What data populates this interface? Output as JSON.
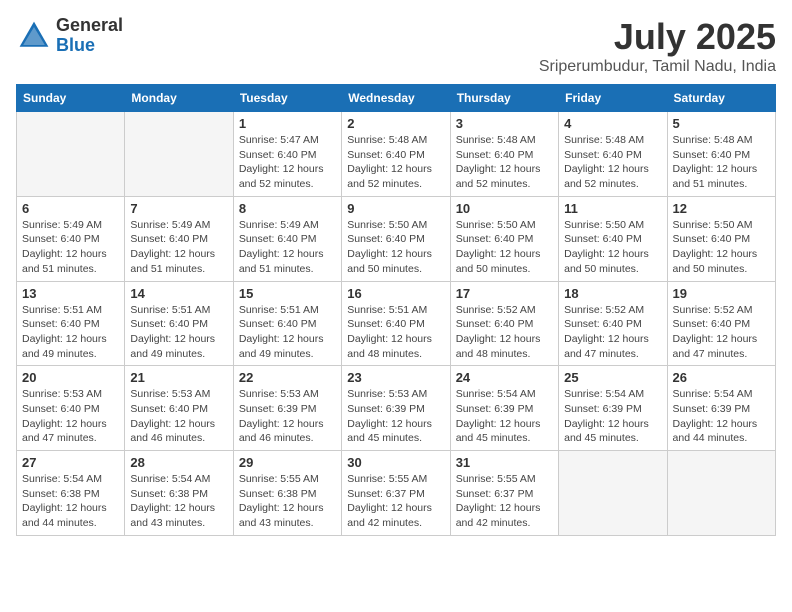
{
  "logo": {
    "general": "General",
    "blue": "Blue"
  },
  "title": {
    "month_year": "July 2025",
    "location": "Sriperumbudur, Tamil Nadu, India"
  },
  "weekdays": [
    "Sunday",
    "Monday",
    "Tuesday",
    "Wednesday",
    "Thursday",
    "Friday",
    "Saturday"
  ],
  "weeks": [
    [
      {
        "day": "",
        "info": ""
      },
      {
        "day": "",
        "info": ""
      },
      {
        "day": "1",
        "info": "Sunrise: 5:47 AM\nSunset: 6:40 PM\nDaylight: 12 hours\nand 52 minutes."
      },
      {
        "day": "2",
        "info": "Sunrise: 5:48 AM\nSunset: 6:40 PM\nDaylight: 12 hours\nand 52 minutes."
      },
      {
        "day": "3",
        "info": "Sunrise: 5:48 AM\nSunset: 6:40 PM\nDaylight: 12 hours\nand 52 minutes."
      },
      {
        "day": "4",
        "info": "Sunrise: 5:48 AM\nSunset: 6:40 PM\nDaylight: 12 hours\nand 52 minutes."
      },
      {
        "day": "5",
        "info": "Sunrise: 5:48 AM\nSunset: 6:40 PM\nDaylight: 12 hours\nand 51 minutes."
      }
    ],
    [
      {
        "day": "6",
        "info": "Sunrise: 5:49 AM\nSunset: 6:40 PM\nDaylight: 12 hours\nand 51 minutes."
      },
      {
        "day": "7",
        "info": "Sunrise: 5:49 AM\nSunset: 6:40 PM\nDaylight: 12 hours\nand 51 minutes."
      },
      {
        "day": "8",
        "info": "Sunrise: 5:49 AM\nSunset: 6:40 PM\nDaylight: 12 hours\nand 51 minutes."
      },
      {
        "day": "9",
        "info": "Sunrise: 5:50 AM\nSunset: 6:40 PM\nDaylight: 12 hours\nand 50 minutes."
      },
      {
        "day": "10",
        "info": "Sunrise: 5:50 AM\nSunset: 6:40 PM\nDaylight: 12 hours\nand 50 minutes."
      },
      {
        "day": "11",
        "info": "Sunrise: 5:50 AM\nSunset: 6:40 PM\nDaylight: 12 hours\nand 50 minutes."
      },
      {
        "day": "12",
        "info": "Sunrise: 5:50 AM\nSunset: 6:40 PM\nDaylight: 12 hours\nand 50 minutes."
      }
    ],
    [
      {
        "day": "13",
        "info": "Sunrise: 5:51 AM\nSunset: 6:40 PM\nDaylight: 12 hours\nand 49 minutes."
      },
      {
        "day": "14",
        "info": "Sunrise: 5:51 AM\nSunset: 6:40 PM\nDaylight: 12 hours\nand 49 minutes."
      },
      {
        "day": "15",
        "info": "Sunrise: 5:51 AM\nSunset: 6:40 PM\nDaylight: 12 hours\nand 49 minutes."
      },
      {
        "day": "16",
        "info": "Sunrise: 5:51 AM\nSunset: 6:40 PM\nDaylight: 12 hours\nand 48 minutes."
      },
      {
        "day": "17",
        "info": "Sunrise: 5:52 AM\nSunset: 6:40 PM\nDaylight: 12 hours\nand 48 minutes."
      },
      {
        "day": "18",
        "info": "Sunrise: 5:52 AM\nSunset: 6:40 PM\nDaylight: 12 hours\nand 47 minutes."
      },
      {
        "day": "19",
        "info": "Sunrise: 5:52 AM\nSunset: 6:40 PM\nDaylight: 12 hours\nand 47 minutes."
      }
    ],
    [
      {
        "day": "20",
        "info": "Sunrise: 5:53 AM\nSunset: 6:40 PM\nDaylight: 12 hours\nand 47 minutes."
      },
      {
        "day": "21",
        "info": "Sunrise: 5:53 AM\nSunset: 6:40 PM\nDaylight: 12 hours\nand 46 minutes."
      },
      {
        "day": "22",
        "info": "Sunrise: 5:53 AM\nSunset: 6:39 PM\nDaylight: 12 hours\nand 46 minutes."
      },
      {
        "day": "23",
        "info": "Sunrise: 5:53 AM\nSunset: 6:39 PM\nDaylight: 12 hours\nand 45 minutes."
      },
      {
        "day": "24",
        "info": "Sunrise: 5:54 AM\nSunset: 6:39 PM\nDaylight: 12 hours\nand 45 minutes."
      },
      {
        "day": "25",
        "info": "Sunrise: 5:54 AM\nSunset: 6:39 PM\nDaylight: 12 hours\nand 45 minutes."
      },
      {
        "day": "26",
        "info": "Sunrise: 5:54 AM\nSunset: 6:39 PM\nDaylight: 12 hours\nand 44 minutes."
      }
    ],
    [
      {
        "day": "27",
        "info": "Sunrise: 5:54 AM\nSunset: 6:38 PM\nDaylight: 12 hours\nand 44 minutes."
      },
      {
        "day": "28",
        "info": "Sunrise: 5:54 AM\nSunset: 6:38 PM\nDaylight: 12 hours\nand 43 minutes."
      },
      {
        "day": "29",
        "info": "Sunrise: 5:55 AM\nSunset: 6:38 PM\nDaylight: 12 hours\nand 43 minutes."
      },
      {
        "day": "30",
        "info": "Sunrise: 5:55 AM\nSunset: 6:37 PM\nDaylight: 12 hours\nand 42 minutes."
      },
      {
        "day": "31",
        "info": "Sunrise: 5:55 AM\nSunset: 6:37 PM\nDaylight: 12 hours\nand 42 minutes."
      },
      {
        "day": "",
        "info": ""
      },
      {
        "day": "",
        "info": ""
      }
    ]
  ]
}
